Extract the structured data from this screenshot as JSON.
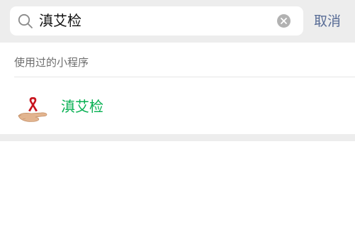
{
  "search": {
    "value": "滇艾检",
    "placeholder": "",
    "cancel_label": "取消"
  },
  "recent_section": {
    "title": "使用过的小程序",
    "items": [
      {
        "name": "滇艾检",
        "icon": "red-ribbon-hand-logo"
      }
    ]
  },
  "colors": {
    "header_bg": "#ededed",
    "accent_link": "#576b95",
    "result_text": "#07b052",
    "ribbon_red": "#c8141e"
  }
}
